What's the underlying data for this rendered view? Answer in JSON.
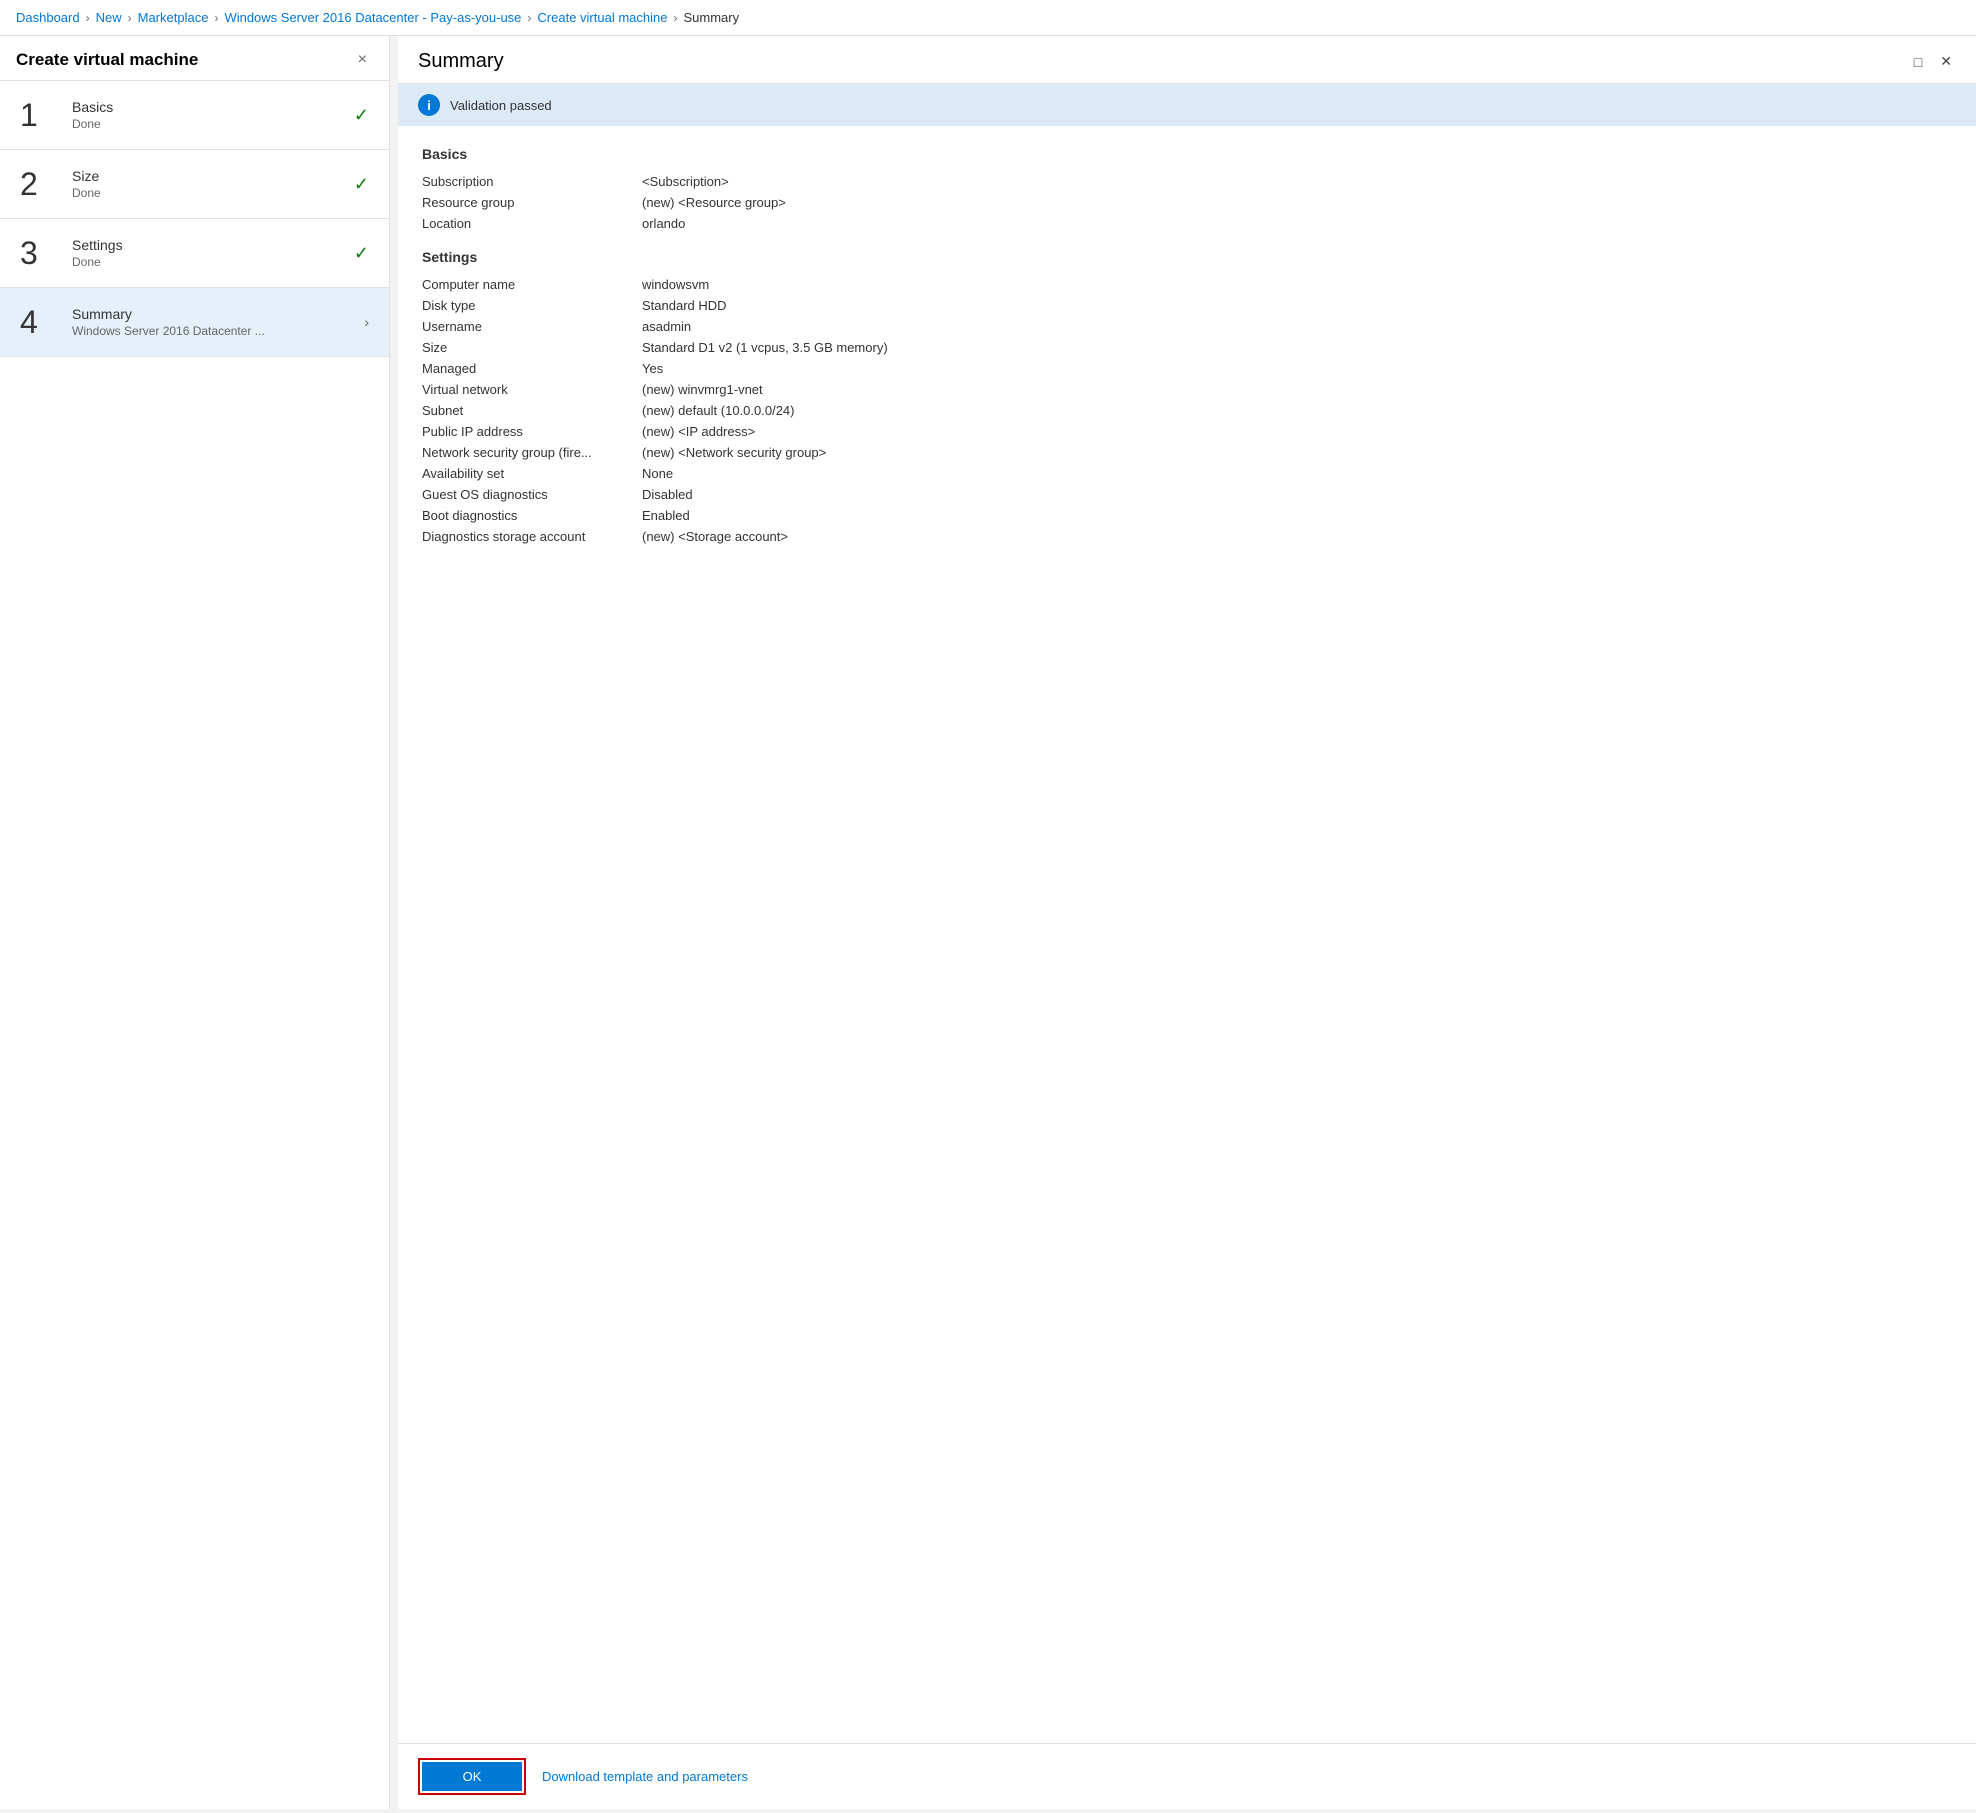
{
  "breadcrumb": {
    "items": [
      {
        "label": "Dashboard",
        "active": true
      },
      {
        "label": "New",
        "active": true
      },
      {
        "label": "Marketplace",
        "active": true
      },
      {
        "label": "Windows Server 2016 Datacenter - Pay-as-you-use",
        "active": true
      },
      {
        "label": "Create virtual machine",
        "active": true
      },
      {
        "label": "Summary",
        "active": false
      }
    ],
    "separators": [
      ">",
      ">",
      ">",
      ">",
      ">"
    ]
  },
  "left_panel": {
    "title": "Create virtual machine",
    "close_label": "×",
    "steps": [
      {
        "number": "1",
        "name": "Basics",
        "status": "Done",
        "done": true,
        "active": false,
        "sub": null
      },
      {
        "number": "2",
        "name": "Size",
        "status": "Done",
        "done": true,
        "active": false,
        "sub": null
      },
      {
        "number": "3",
        "name": "Settings",
        "status": "Done",
        "done": true,
        "active": false,
        "sub": null
      },
      {
        "number": "4",
        "name": "Summary",
        "status": null,
        "done": false,
        "active": true,
        "sub": "Windows Server 2016 Datacenter ..."
      }
    ]
  },
  "right_panel": {
    "title": "Summary",
    "validation": {
      "icon": "i",
      "message": "Validation passed"
    },
    "sections": [
      {
        "title": "Basics",
        "rows": [
          {
            "label": "Subscription",
            "value": "<Subscription>"
          },
          {
            "label": "Resource group",
            "value": "(new) <Resource group>"
          },
          {
            "label": "Location",
            "value": "orlando"
          }
        ]
      },
      {
        "title": "Settings",
        "rows": [
          {
            "label": "Computer name",
            "value": "windowsvm"
          },
          {
            "label": "Disk type",
            "value": "Standard HDD"
          },
          {
            "label": "Username",
            "value": "asadmin"
          },
          {
            "label": "Size",
            "value": "Standard D1 v2 (1 vcpus, 3.5 GB memory)"
          },
          {
            "label": "Managed",
            "value": "Yes"
          },
          {
            "label": "Virtual network",
            "value": "(new) winvmrg1-vnet"
          },
          {
            "label": "Subnet",
            "value": "(new) default (10.0.0.0/24)"
          },
          {
            "label": "Public IP address",
            "value": "(new) <IP address>"
          },
          {
            "label": "Network security group (fire...",
            "value": "(new) <Network security group>"
          },
          {
            "label": "Availability set",
            "value": "None"
          },
          {
            "label": "Guest OS diagnostics",
            "value": "Disabled"
          },
          {
            "label": "Boot diagnostics",
            "value": "Enabled"
          },
          {
            "label": "Diagnostics storage account",
            "value": " (new) <Storage account>"
          }
        ]
      }
    ],
    "footer": {
      "ok_label": "OK",
      "download_label": "Download template and parameters"
    }
  }
}
